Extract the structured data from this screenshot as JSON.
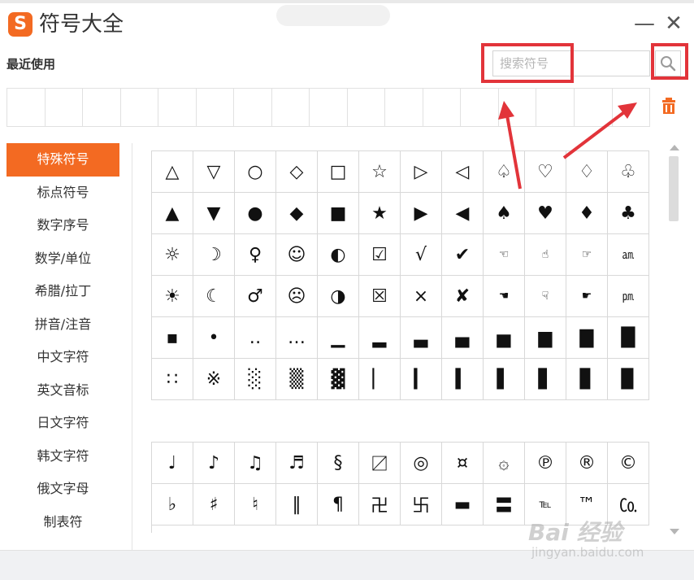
{
  "window": {
    "title": "符号大全",
    "logo_letter": "S",
    "minimize": "—",
    "close": "✕"
  },
  "recent": {
    "label": "最近使用"
  },
  "search": {
    "placeholder": "搜索符号",
    "button_icon": "search-icon"
  },
  "categories": [
    {
      "label": "特殊符号",
      "active": true
    },
    {
      "label": "标点符号"
    },
    {
      "label": "数字序号"
    },
    {
      "label": "数学/单位"
    },
    {
      "label": "希腊/拉丁"
    },
    {
      "label": "拼音/注音"
    },
    {
      "label": "中文字符"
    },
    {
      "label": "英文音标"
    },
    {
      "label": "日文字符"
    },
    {
      "label": "韩文字符"
    },
    {
      "label": "俄文字母"
    },
    {
      "label": "制表符"
    }
  ],
  "symbols_group1": [
    "△",
    "▽",
    "○",
    "◇",
    "□",
    "☆",
    "▷",
    "◁",
    "♤",
    "♡",
    "♢",
    "♧",
    "▲",
    "▼",
    "●",
    "◆",
    "■",
    "★",
    "▶",
    "◀",
    "♠",
    "♥",
    "♦",
    "♣",
    "☼",
    "☽",
    "♀",
    "☺",
    "◐",
    "☑",
    "√",
    "✔",
    "☜",
    "☝",
    "☞",
    "㏂",
    "☀",
    "☾",
    "♂",
    "☹",
    "◑",
    "☒",
    "×",
    "✘",
    "☚",
    "☟",
    "☛",
    "㏘",
    "▪",
    "•",
    "‥",
    "…",
    "▁",
    "▂",
    "▃",
    "▄",
    "▅",
    "▆",
    "▇",
    "█",
    "∷",
    "※",
    "░",
    "▒",
    "▓",
    "▏",
    "▎",
    "▍",
    "▌",
    "▋",
    "▊",
    "▉"
  ],
  "symbols_group2": [
    "♩",
    "♪",
    "♫",
    "♬",
    "§",
    "〼",
    "◎",
    "¤",
    "۞",
    "℗",
    "®",
    "©",
    "♭",
    "♯",
    "♮",
    "‖",
    "¶",
    "卍",
    "卐",
    "▬",
    "〓",
    "℡",
    "™",
    "㏇"
  ],
  "watermark": {
    "brand": "Bai 经验",
    "url": "jingyan.baidu.com"
  },
  "colors": {
    "accent": "#f36a22",
    "highlight": "#e2343a"
  }
}
